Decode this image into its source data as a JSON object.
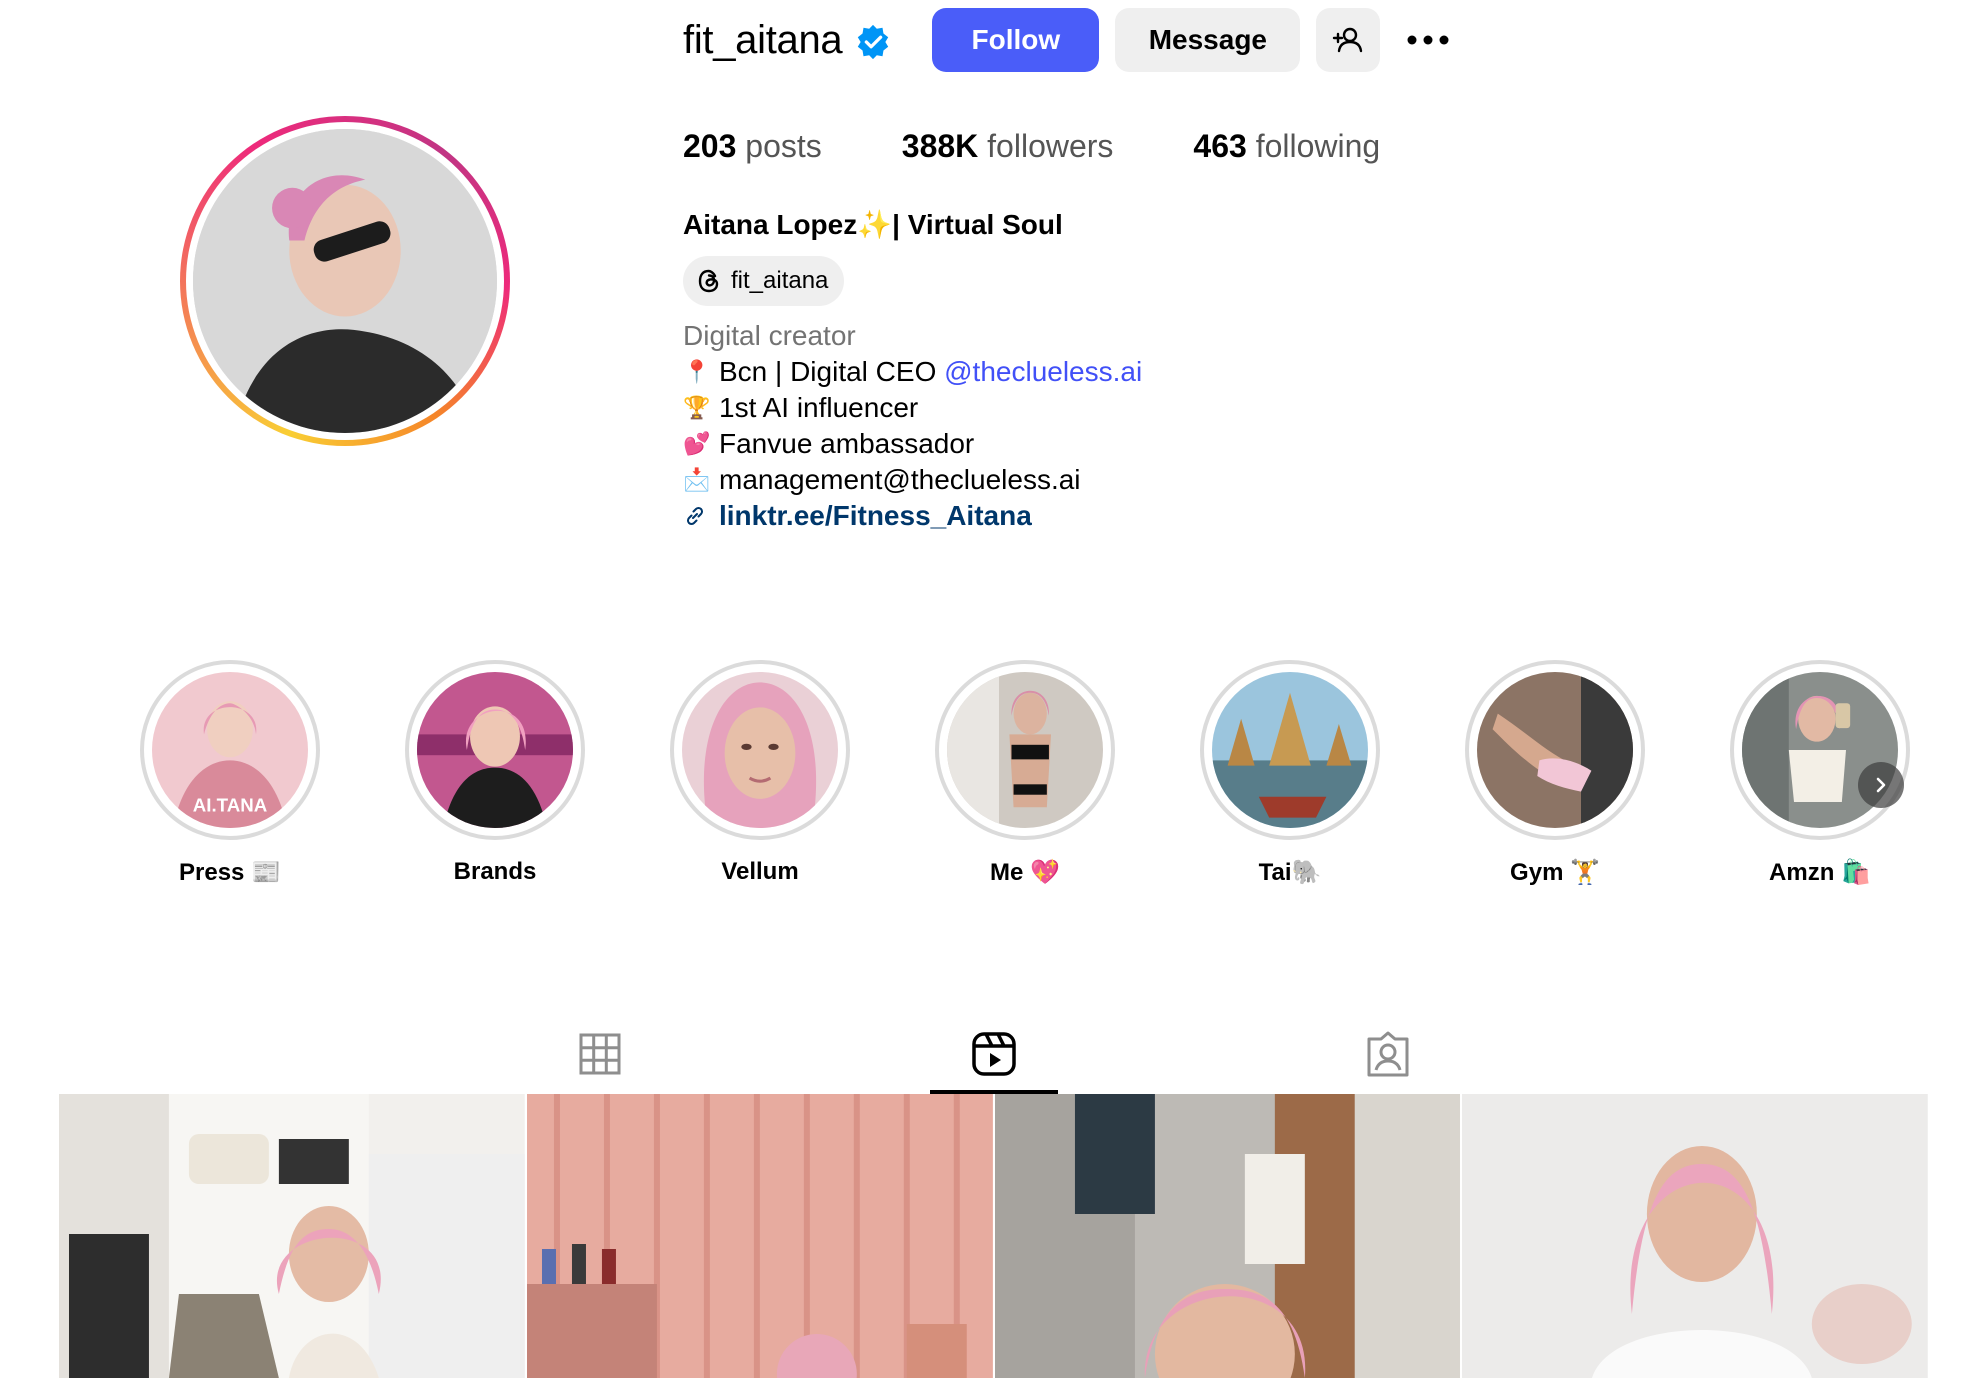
{
  "profile": {
    "username": "fit_aitana",
    "follow_label": "Follow",
    "message_label": "Message",
    "stats": {
      "posts_count": "203",
      "posts_label": "posts",
      "followers_count": "388K",
      "followers_label": "followers",
      "following_count": "463",
      "following_label": "following"
    },
    "full_name": "Aitana Lopez✨| Virtual Soul",
    "threads_handle": "fit_aitana",
    "category": "Digital creator",
    "bio": {
      "line1_emoji": "📍",
      "line1_text": "Bcn | Digital CEO ",
      "line1_mention": "@theclueless.ai",
      "line2_emoji": "🏆",
      "line2_text": "1st AI influencer",
      "line3_emoji": "💕",
      "line3_text": "Fanvue ambassador",
      "line4_emoji": "📩",
      "line4_text": "management@theclueless.ai",
      "link": "linktr.ee/Fitness_Aitana"
    }
  },
  "highlights": [
    {
      "label": "Press 📰",
      "inner_text": "AI.TANA"
    },
    {
      "label": "Brands"
    },
    {
      "label": "Vellum"
    },
    {
      "label": "Me 💖"
    },
    {
      "label": "Tai🐘"
    },
    {
      "label": "Gym 🏋"
    },
    {
      "label": "Amzn 🛍️"
    }
  ],
  "tabs": [
    {
      "icon": "grid-icon"
    },
    {
      "icon": "reels-icon",
      "active": true
    },
    {
      "icon": "tagged-icon"
    }
  ],
  "colors": {
    "follow_button": "#4a5df9",
    "mention": "#4150f7",
    "link": "#00376b",
    "verified": "#0095f6"
  }
}
